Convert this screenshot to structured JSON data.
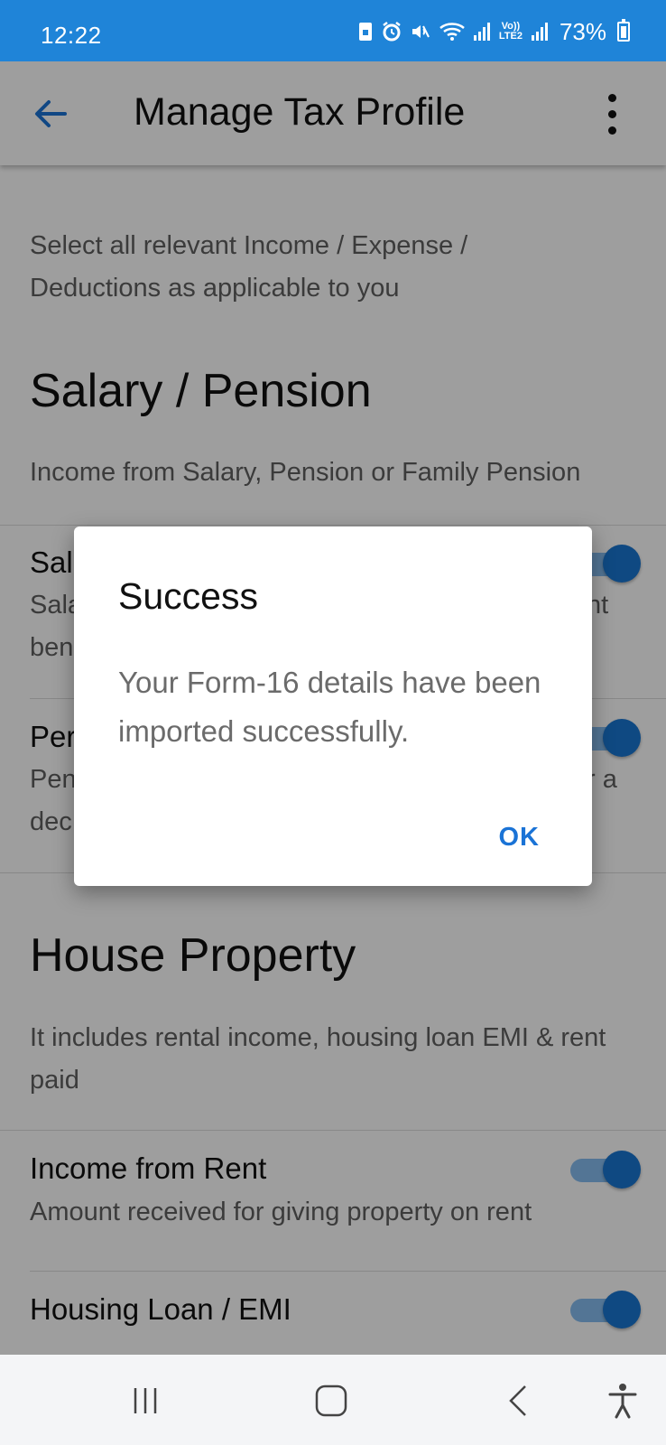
{
  "status_bar": {
    "time": "12:22",
    "battery_percent": "73%",
    "icons": [
      "sim-lock-icon",
      "alarm-icon",
      "mute-icon",
      "wifi-icon",
      "signal-icon",
      "volte-lte2-icon",
      "signal-icon",
      "battery-icon"
    ],
    "volte_label": "Vo)) LTE2",
    "background_color": "#1f84d8"
  },
  "app_bar": {
    "title": "Manage Tax Profile",
    "back_icon": "arrow-left-icon",
    "menu_icon": "more-vertical-icon"
  },
  "intro_text": "Select all relevant Income / Expense / Deductions as applicable to you",
  "sections": [
    {
      "title": "Salary / Pension",
      "subtitle": "Income from Salary, Pension or Family Pension",
      "rows": [
        {
          "title_visible": "Sal",
          "subtitle_visible": "Sala",
          "subtitle_right": "nt",
          "subtitle_line2": "ben",
          "toggle_on": true
        },
        {
          "title_visible": "Per",
          "subtitle_visible": "Pen",
          "subtitle_right": "r a",
          "subtitle_line2": "dec",
          "toggle_on": true
        }
      ]
    },
    {
      "title": "House Property",
      "subtitle": "It includes rental income, housing loan EMI & rent paid",
      "rows": [
        {
          "title": "Income from Rent",
          "subtitle": "Amount received for giving property on rent",
          "toggle_on": true
        },
        {
          "title": "Housing Loan / EMI",
          "toggle_on": true
        }
      ]
    }
  ],
  "dialog": {
    "title": "Success",
    "message": "Your Form-16 details have been imported successfully.",
    "ok_label": "OK",
    "accent_color": "#1a73d6"
  },
  "nav_bar": {
    "icons": [
      "recent-apps-icon",
      "home-icon",
      "back-icon",
      "accessibility-icon"
    ]
  }
}
